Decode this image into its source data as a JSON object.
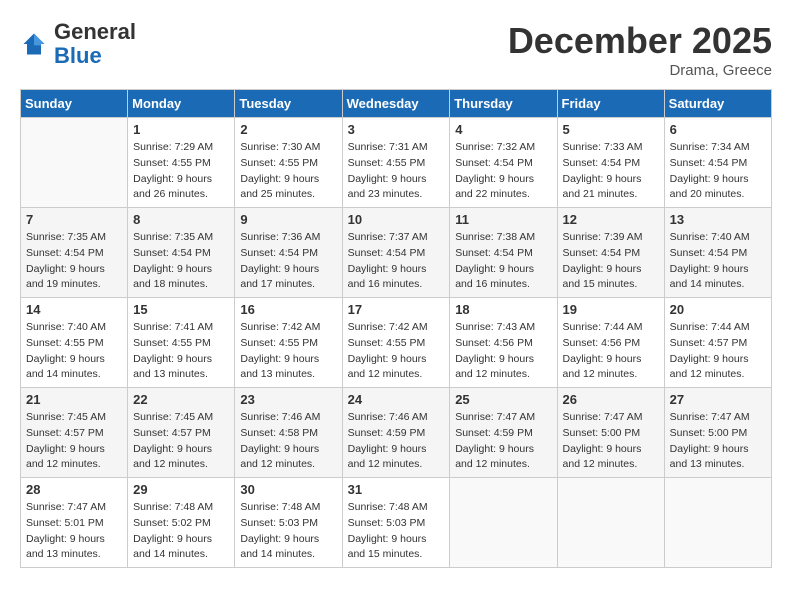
{
  "header": {
    "logo_general": "General",
    "logo_blue": "Blue",
    "month_title": "December 2025",
    "location": "Drama, Greece"
  },
  "days_of_week": [
    "Sunday",
    "Monday",
    "Tuesday",
    "Wednesday",
    "Thursday",
    "Friday",
    "Saturday"
  ],
  "weeks": [
    [
      {
        "day": "",
        "info": ""
      },
      {
        "day": "1",
        "info": "Sunrise: 7:29 AM\nSunset: 4:55 PM\nDaylight: 9 hours\nand 26 minutes."
      },
      {
        "day": "2",
        "info": "Sunrise: 7:30 AM\nSunset: 4:55 PM\nDaylight: 9 hours\nand 25 minutes."
      },
      {
        "day": "3",
        "info": "Sunrise: 7:31 AM\nSunset: 4:55 PM\nDaylight: 9 hours\nand 23 minutes."
      },
      {
        "day": "4",
        "info": "Sunrise: 7:32 AM\nSunset: 4:54 PM\nDaylight: 9 hours\nand 22 minutes."
      },
      {
        "day": "5",
        "info": "Sunrise: 7:33 AM\nSunset: 4:54 PM\nDaylight: 9 hours\nand 21 minutes."
      },
      {
        "day": "6",
        "info": "Sunrise: 7:34 AM\nSunset: 4:54 PM\nDaylight: 9 hours\nand 20 minutes."
      }
    ],
    [
      {
        "day": "7",
        "info": "Sunrise: 7:35 AM\nSunset: 4:54 PM\nDaylight: 9 hours\nand 19 minutes."
      },
      {
        "day": "8",
        "info": "Sunrise: 7:35 AM\nSunset: 4:54 PM\nDaylight: 9 hours\nand 18 minutes."
      },
      {
        "day": "9",
        "info": "Sunrise: 7:36 AM\nSunset: 4:54 PM\nDaylight: 9 hours\nand 17 minutes."
      },
      {
        "day": "10",
        "info": "Sunrise: 7:37 AM\nSunset: 4:54 PM\nDaylight: 9 hours\nand 16 minutes."
      },
      {
        "day": "11",
        "info": "Sunrise: 7:38 AM\nSunset: 4:54 PM\nDaylight: 9 hours\nand 16 minutes."
      },
      {
        "day": "12",
        "info": "Sunrise: 7:39 AM\nSunset: 4:54 PM\nDaylight: 9 hours\nand 15 minutes."
      },
      {
        "day": "13",
        "info": "Sunrise: 7:40 AM\nSunset: 4:54 PM\nDaylight: 9 hours\nand 14 minutes."
      }
    ],
    [
      {
        "day": "14",
        "info": "Sunrise: 7:40 AM\nSunset: 4:55 PM\nDaylight: 9 hours\nand 14 minutes."
      },
      {
        "day": "15",
        "info": "Sunrise: 7:41 AM\nSunset: 4:55 PM\nDaylight: 9 hours\nand 13 minutes."
      },
      {
        "day": "16",
        "info": "Sunrise: 7:42 AM\nSunset: 4:55 PM\nDaylight: 9 hours\nand 13 minutes."
      },
      {
        "day": "17",
        "info": "Sunrise: 7:42 AM\nSunset: 4:55 PM\nDaylight: 9 hours\nand 12 minutes."
      },
      {
        "day": "18",
        "info": "Sunrise: 7:43 AM\nSunset: 4:56 PM\nDaylight: 9 hours\nand 12 minutes."
      },
      {
        "day": "19",
        "info": "Sunrise: 7:44 AM\nSunset: 4:56 PM\nDaylight: 9 hours\nand 12 minutes."
      },
      {
        "day": "20",
        "info": "Sunrise: 7:44 AM\nSunset: 4:57 PM\nDaylight: 9 hours\nand 12 minutes."
      }
    ],
    [
      {
        "day": "21",
        "info": "Sunrise: 7:45 AM\nSunset: 4:57 PM\nDaylight: 9 hours\nand 12 minutes."
      },
      {
        "day": "22",
        "info": "Sunrise: 7:45 AM\nSunset: 4:57 PM\nDaylight: 9 hours\nand 12 minutes."
      },
      {
        "day": "23",
        "info": "Sunrise: 7:46 AM\nSunset: 4:58 PM\nDaylight: 9 hours\nand 12 minutes."
      },
      {
        "day": "24",
        "info": "Sunrise: 7:46 AM\nSunset: 4:59 PM\nDaylight: 9 hours\nand 12 minutes."
      },
      {
        "day": "25",
        "info": "Sunrise: 7:47 AM\nSunset: 4:59 PM\nDaylight: 9 hours\nand 12 minutes."
      },
      {
        "day": "26",
        "info": "Sunrise: 7:47 AM\nSunset: 5:00 PM\nDaylight: 9 hours\nand 12 minutes."
      },
      {
        "day": "27",
        "info": "Sunrise: 7:47 AM\nSunset: 5:00 PM\nDaylight: 9 hours\nand 13 minutes."
      }
    ],
    [
      {
        "day": "28",
        "info": "Sunrise: 7:47 AM\nSunset: 5:01 PM\nDaylight: 9 hours\nand 13 minutes."
      },
      {
        "day": "29",
        "info": "Sunrise: 7:48 AM\nSunset: 5:02 PM\nDaylight: 9 hours\nand 14 minutes."
      },
      {
        "day": "30",
        "info": "Sunrise: 7:48 AM\nSunset: 5:03 PM\nDaylight: 9 hours\nand 14 minutes."
      },
      {
        "day": "31",
        "info": "Sunrise: 7:48 AM\nSunset: 5:03 PM\nDaylight: 9 hours\nand 15 minutes."
      },
      {
        "day": "",
        "info": ""
      },
      {
        "day": "",
        "info": ""
      },
      {
        "day": "",
        "info": ""
      }
    ]
  ]
}
